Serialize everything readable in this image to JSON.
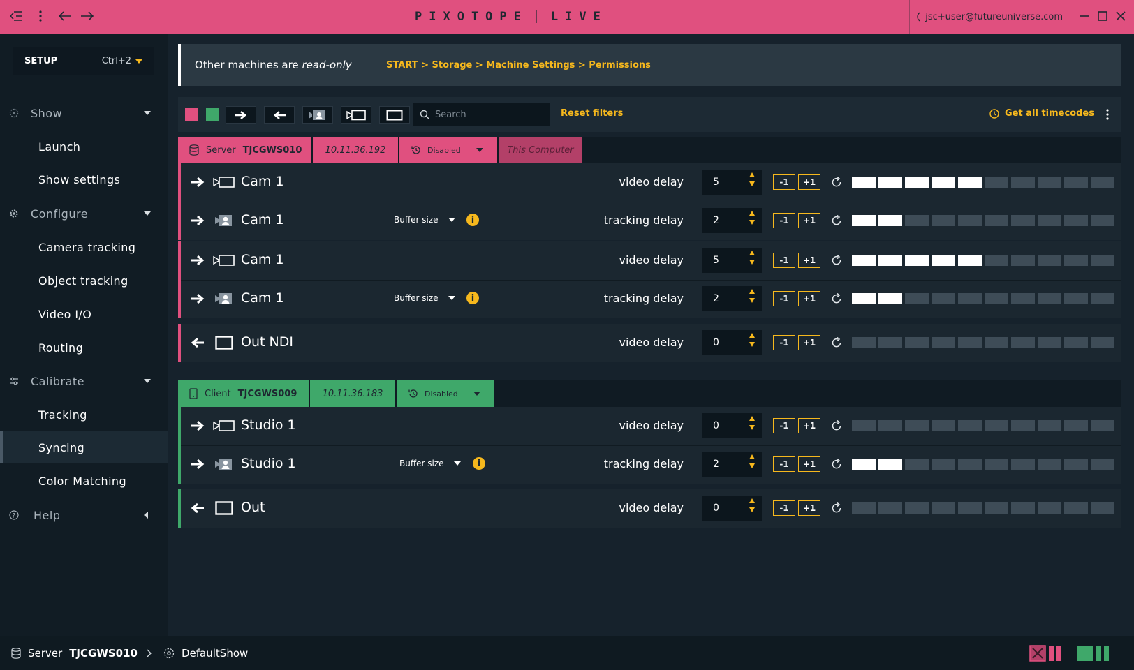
{
  "titlebar": {
    "brand_left": "PIXOTOPE",
    "brand_right": "LIVE",
    "user_email": "jsc+user@futureuniverse.com"
  },
  "sidebar": {
    "mode_label": "SETUP",
    "mode_shortcut": "Ctrl+2",
    "sections": [
      {
        "label": "Show",
        "items": [
          "Launch",
          "Show settings"
        ]
      },
      {
        "label": "Configure",
        "items": [
          "Camera tracking",
          "Object tracking",
          "Video I/O",
          "Routing"
        ]
      },
      {
        "label": "Calibrate",
        "items": [
          "Tracking",
          "Syncing",
          "Color Matching"
        ]
      },
      {
        "label": "Help",
        "items": []
      }
    ],
    "active_item": "Syncing"
  },
  "notice": {
    "message_prefix": "Other machines are ",
    "message_emphasis": "read-only",
    "breadcrumb": "START > Storage > Machine Settings > Permissions"
  },
  "toolbar": {
    "swatch_colors": [
      "#e0507f",
      "#3fa86a"
    ],
    "search_placeholder": "Search",
    "reset_filters_label": "Reset filters",
    "timecodes_label": "Get all timecodes"
  },
  "server": {
    "role": "Server",
    "name": "TJCGWS010",
    "ip": "10.11.36.192",
    "sync_status": "Disabled",
    "tag": "This Computer",
    "rows": [
      {
        "dir": "in",
        "device": "video",
        "name": "Cam 1",
        "buffer": "",
        "delay_label": "video delay",
        "value": "5",
        "level": 5
      },
      {
        "dir": "in",
        "device": "tracking",
        "name": "Cam 1",
        "buffer": "Buffer size",
        "delay_label": "tracking delay",
        "value": "2",
        "level": 2
      },
      {
        "dir": "in",
        "device": "video",
        "name": "Cam 1",
        "buffer": "",
        "delay_label": "video delay",
        "value": "5",
        "level": 5
      },
      {
        "dir": "in",
        "device": "tracking",
        "name": "Cam 1",
        "buffer": "Buffer size",
        "delay_label": "tracking delay",
        "value": "2",
        "level": 2
      },
      {
        "dir": "out",
        "device": "output",
        "name": "Out NDI",
        "buffer": "",
        "delay_label": "video delay",
        "value": "0",
        "level": 0
      }
    ]
  },
  "client": {
    "role": "Client",
    "name": "TJCGWS009",
    "ip": "10.11.36.183",
    "sync_status": "Disabled",
    "rows": [
      {
        "dir": "in",
        "device": "video",
        "name": "Studio 1",
        "buffer": "",
        "delay_label": "video delay",
        "value": "0",
        "level": 0
      },
      {
        "dir": "in",
        "device": "tracking",
        "name": "Studio 1",
        "buffer": "Buffer size",
        "delay_label": "tracking delay",
        "value": "2",
        "level": 2
      },
      {
        "dir": "out",
        "device": "output",
        "name": "Out",
        "buffer": "",
        "delay_label": "video delay",
        "value": "0",
        "level": 0
      }
    ]
  },
  "stepper": {
    "minus_label": "-1",
    "plus_label": "+1"
  },
  "statusbar": {
    "role": "Server",
    "machine": "TJCGWS010",
    "show": "DefaultShow"
  }
}
